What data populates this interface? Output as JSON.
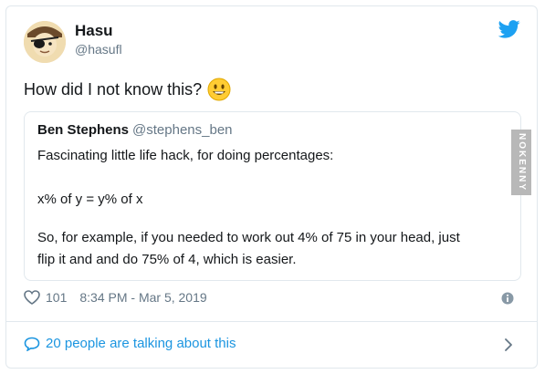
{
  "tweet": {
    "display_name": "Hasu",
    "handle": "@hasufl",
    "text": "How did I not know this?",
    "emoji": "grinning-face-emoji"
  },
  "quoted": {
    "display_name": "Ben Stephens",
    "handle": "@stephens_ben",
    "lines": [
      "Fascinating little life hack, for doing percentages:",
      "x% of y = y% of x",
      "So, for example, if you needed to work out 4% of 75 in your head, just",
      "flip it and and do 75% of 4, which is easier."
    ]
  },
  "meta": {
    "likes": "101",
    "timestamp": "8:34 PM - Mar 5, 2019"
  },
  "footer": {
    "talking": "20 people are talking about this"
  },
  "watermark": "NOKENNY",
  "colors": {
    "accent": "#1da1f2",
    "link": "#1b95e0",
    "secondary_text": "#657786",
    "border": "#e1e8ed"
  }
}
